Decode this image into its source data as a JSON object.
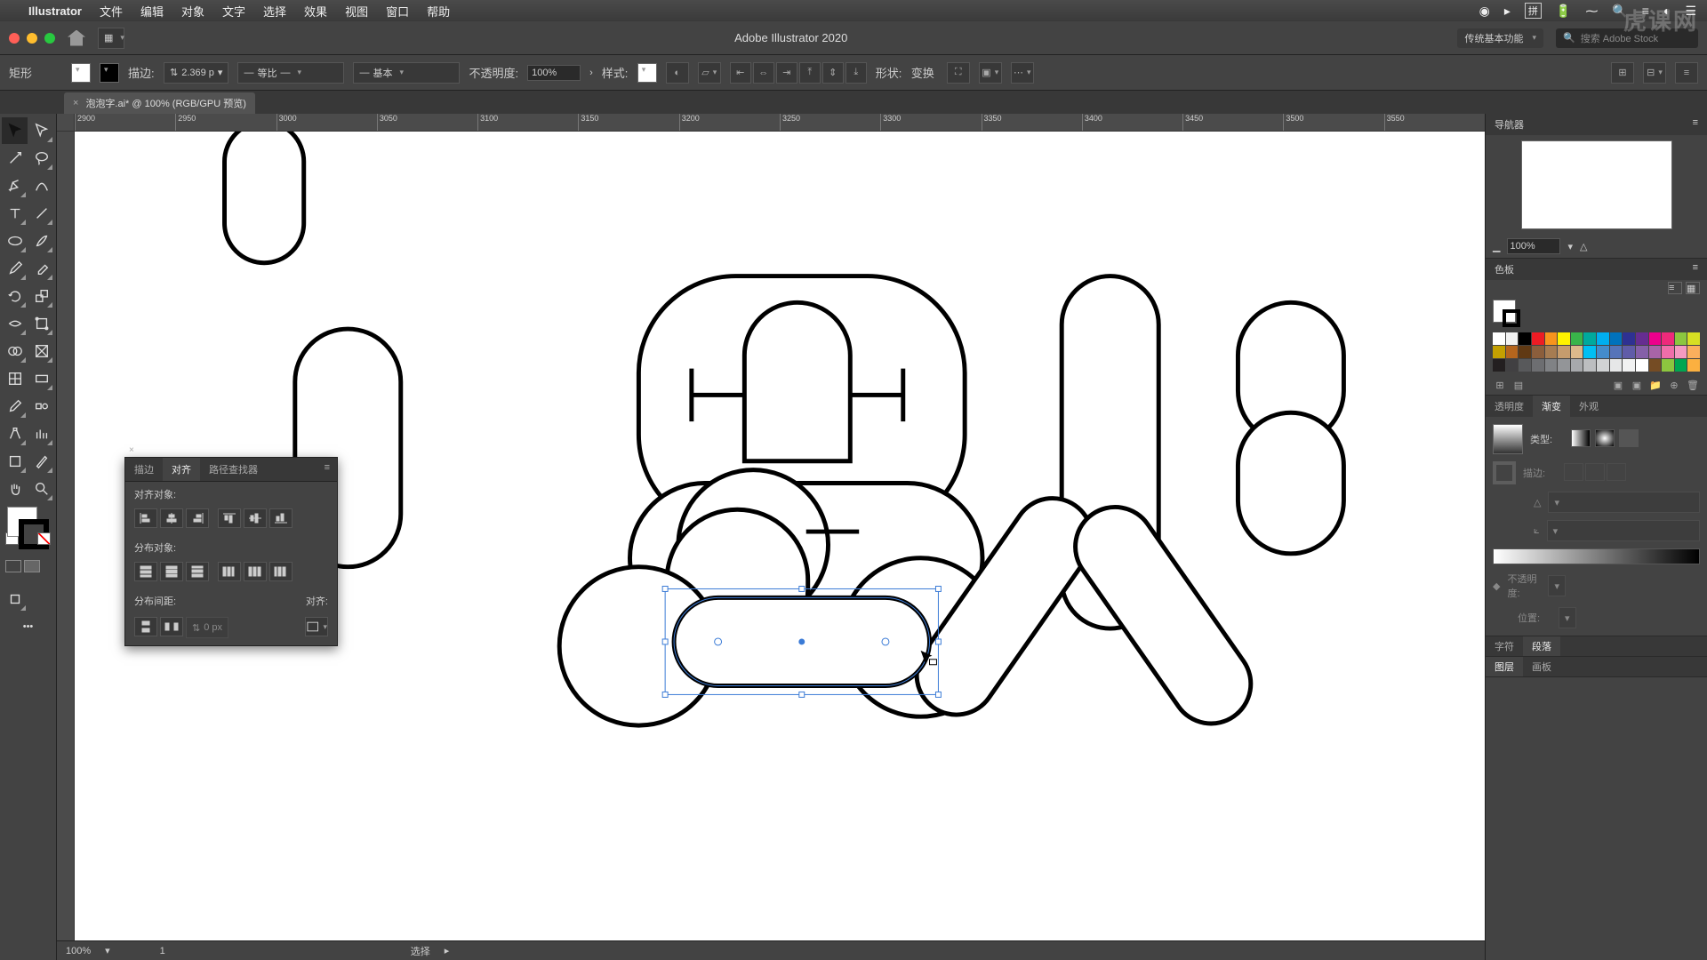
{
  "menubar": {
    "app": "Illustrator",
    "items": [
      "文件",
      "编辑",
      "对象",
      "文字",
      "选择",
      "效果",
      "视图",
      "窗口",
      "帮助"
    ],
    "right_icons": [
      "record-icon",
      "play-icon",
      "pinyin-icon",
      "battery-icon",
      "wifi-icon",
      "spotlight-icon",
      "menu-icon",
      "siri-icon",
      "user-icon"
    ],
    "pinyin_label": "拼"
  },
  "titlebar": {
    "title": "Adobe Illustrator 2020",
    "workspace": "传统基本功能",
    "search_placeholder": "搜索 Adobe Stock"
  },
  "controlbar": {
    "selection_label": "矩形",
    "stroke_label": "描边:",
    "stroke_weight": "2.369 p",
    "profile": "等比",
    "brush": "基本",
    "opacity_label": "不透明度:",
    "opacity_value": "100%",
    "style_label": "样式:",
    "shape_label": "形状:",
    "transform": "变换"
  },
  "doc_tab": {
    "name": "泡泡字.ai* @ 100% (RGB/GPU 预览)"
  },
  "ruler_ticks": [
    "2900",
    "2950",
    "3000",
    "3050",
    "3100",
    "3150",
    "3200",
    "3250",
    "3300",
    "3350",
    "3400",
    "3450",
    "3500",
    "3550"
  ],
  "align_panel": {
    "tabs": [
      "描边",
      "对齐",
      "路径查找器"
    ],
    "active_tab": 1,
    "section1": "对齐对象:",
    "section2": "分布对象:",
    "section3": "分布间距:",
    "section4": "对齐:",
    "spacing_value": "0 px"
  },
  "right": {
    "navigator": {
      "title": "导航器",
      "zoom": "100%"
    },
    "swatches": {
      "title": "色板"
    },
    "gradient": {
      "tabs": [
        "透明度",
        "渐变",
        "外观"
      ],
      "active": 1,
      "type_label": "类型:",
      "stroke_label": "描边:",
      "opacity_label": "不透明度:",
      "location_label": "位置:"
    },
    "char_para": {
      "tabs": [
        "字符",
        "段落"
      ],
      "active": 1
    },
    "layers": {
      "tabs": [
        "图层",
        "画板"
      ],
      "active": 0
    }
  },
  "status": {
    "zoom": "100%",
    "artboard": "1",
    "tool": "选择"
  },
  "swatch_colors": [
    "#ffffff",
    "#f2f2f2",
    "#000000",
    "#ed1c24",
    "#f7941d",
    "#fff200",
    "#39b54a",
    "#00a99d",
    "#00aeef",
    "#0072bc",
    "#2e3192",
    "#662d91",
    "#ec008c",
    "#ee2a7b",
    "#8cc63f",
    "#d7df23",
    "#c4a000",
    "#b5651d",
    "#603913",
    "#8b5e3c",
    "#a67c52",
    "#c69c6d",
    "#dcb98b",
    "#00bff3",
    "#448ccb",
    "#5674b9",
    "#605ca8",
    "#8560a8",
    "#a864a8",
    "#f06eaa",
    "#f49ac1",
    "#fbaf5d",
    "#231f20",
    "#414042",
    "#58595b",
    "#6d6e71",
    "#808285",
    "#939598",
    "#a7a9ac",
    "#bcbec0",
    "#d1d3d4",
    "#e6e7e8",
    "#f1f2f2",
    "#ffffff",
    "#754c24",
    "#8dc63f",
    "#00a651",
    "#fbb040"
  ],
  "watermark": "虎课网"
}
